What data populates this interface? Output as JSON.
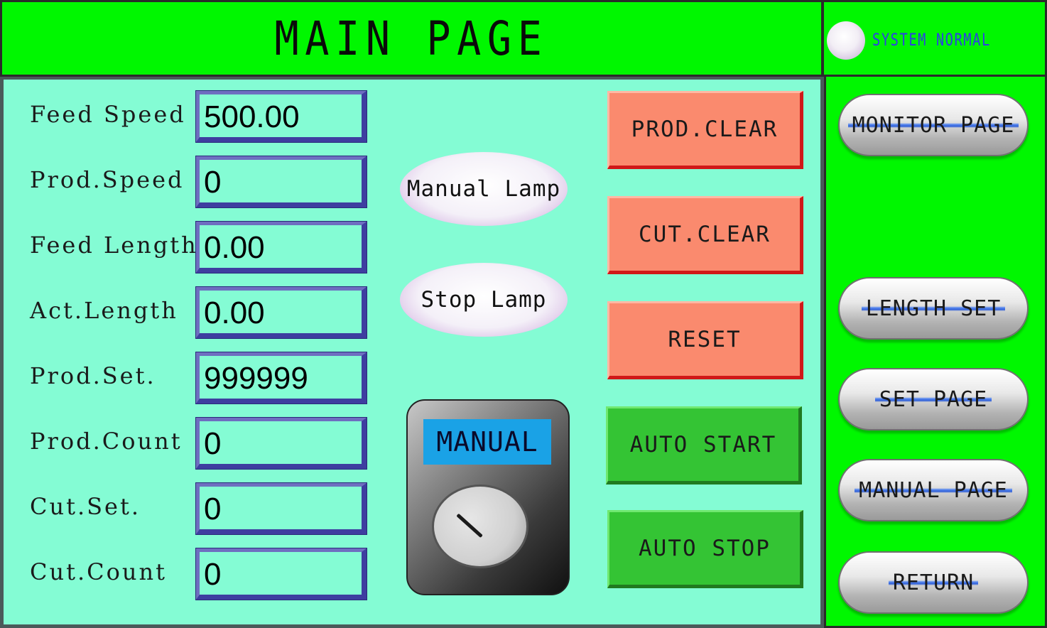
{
  "header": {
    "title": "MAIN PAGE",
    "status_text": "SYSTEM NORMAL"
  },
  "fields": [
    {
      "label": "Feed Speed",
      "value": "500.00"
    },
    {
      "label": "Prod.Speed",
      "value": "0"
    },
    {
      "label": "Feed Length",
      "value": "0.00"
    },
    {
      "label": "Act.Length",
      "value": "0.00"
    },
    {
      "label": "Prod.Set.",
      "value": "999999"
    },
    {
      "label": "Prod.Count",
      "value": "0"
    },
    {
      "label": "Cut.Set.",
      "value": "0"
    },
    {
      "label": "Cut.Count",
      "value": "0"
    }
  ],
  "lamps": {
    "manual": "Manual Lamp",
    "stop": "Stop Lamp"
  },
  "selector": {
    "mode": "MANUAL"
  },
  "actions": {
    "prod_clear": "PROD.CLEAR",
    "cut_clear": "CUT.CLEAR",
    "reset": "RESET",
    "auto_start": "AUTO START",
    "auto_stop": "AUTO STOP"
  },
  "nav": {
    "monitor": "MONITOR PAGE",
    "length_set": "LENGTH SET",
    "set_page": "SET PAGE",
    "manual_page": "MANUAL PAGE",
    "return": "RETURN"
  },
  "colors": {
    "header_green": "#00f700",
    "panel_mint": "#84fcd4",
    "button_red": "#fa8a6e",
    "button_green": "#34c434",
    "mode_blue": "#1aa2e6",
    "status_blue": "#2d3fe6"
  }
}
